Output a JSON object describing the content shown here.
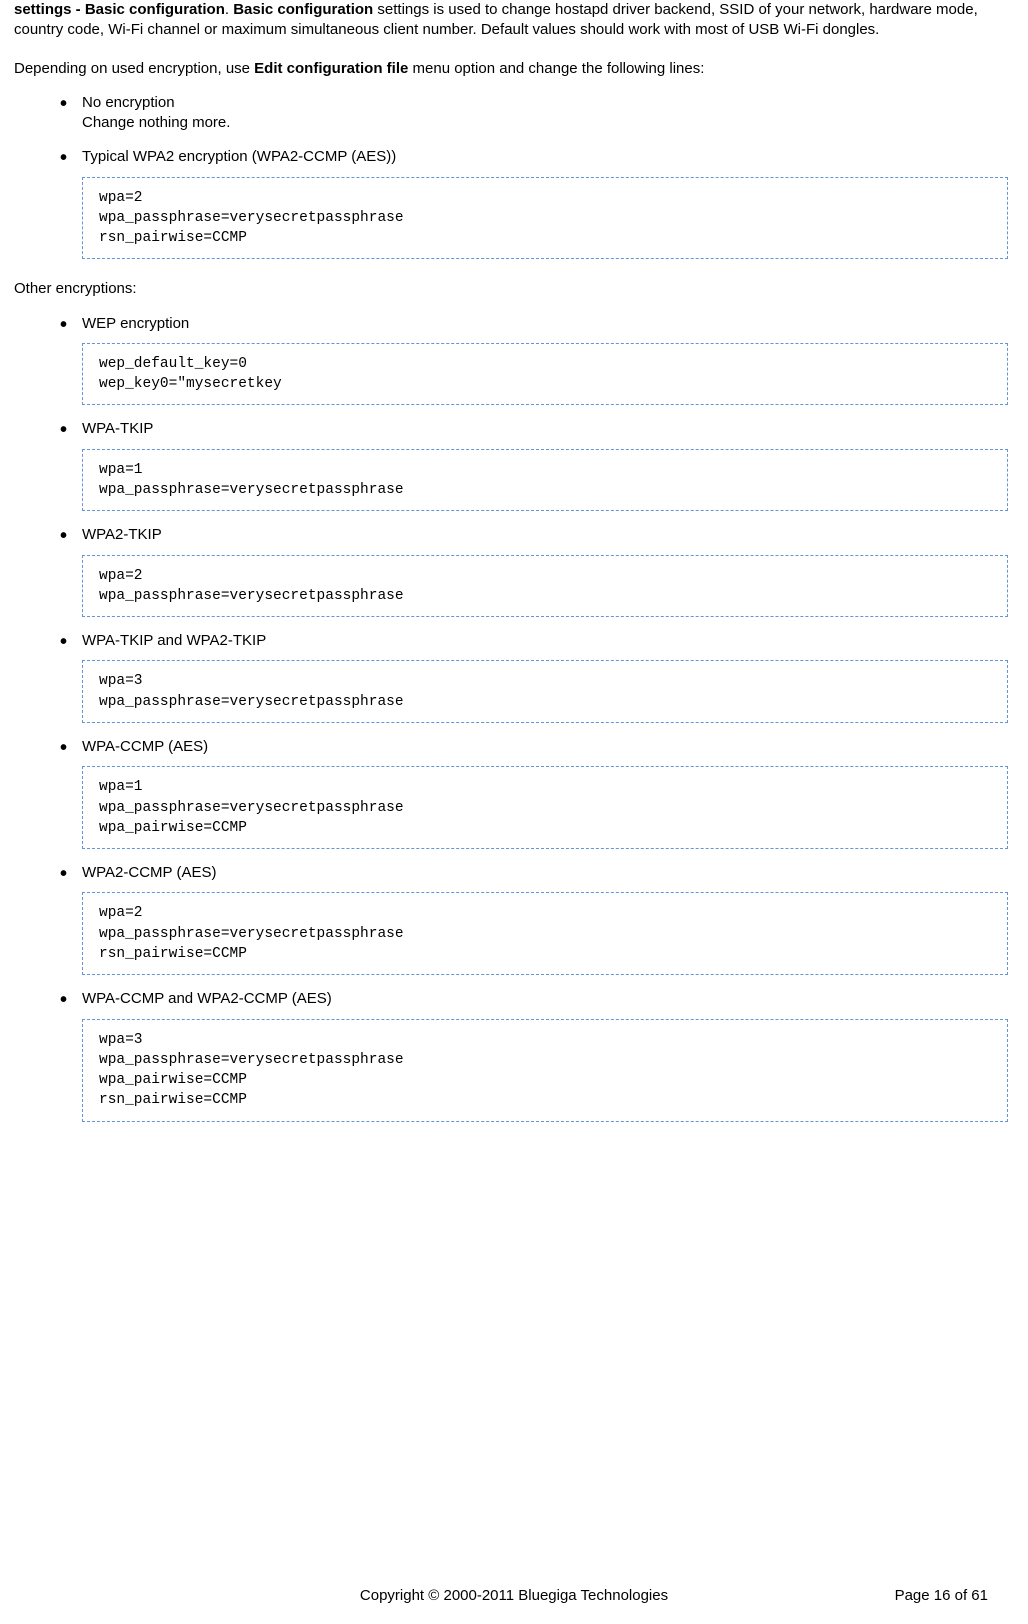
{
  "intro": {
    "prefix_bold": "settings - Basic configuration",
    "dot": ". ",
    "bold2": "Basic configuration",
    "rest": " settings is used to change hostapd driver backend, SSID of your network, hardware mode, country code, Wi-Fi channel or maximum simultaneous client number. Default values should work with most of USB Wi-Fi dongles."
  },
  "depending": {
    "pre": "Depending on used encryption, use ",
    "bold": "Edit configuration file",
    "post": " menu option and change the following lines:"
  },
  "list1": [
    {
      "title": "No encryption",
      "subtitle": "Change nothing more.",
      "code": null
    },
    {
      "title": "Typical WPA2 encryption (WPA2-CCMP (AES))",
      "subtitle": null,
      "code": "wpa=2\nwpa_passphrase=verysecretpassphrase\nrsn_pairwise=CCMP"
    }
  ],
  "other_heading": "Other encryptions:",
  "list2": [
    {
      "title": "WEP encryption",
      "code": "wep_default_key=0\nwep_key0=\"mysecretkey"
    },
    {
      "title": "WPA-TKIP",
      "code": "wpa=1\nwpa_passphrase=verysecretpassphrase"
    },
    {
      "title": "WPA2-TKIP",
      "code": "wpa=2\nwpa_passphrase=verysecretpassphrase"
    },
    {
      "title": "WPA-TKIP and WPA2-TKIP",
      "code": "wpa=3\nwpa_passphrase=verysecretpassphrase"
    },
    {
      "title": "WPA-CCMP (AES)",
      "code": "wpa=1\nwpa_passphrase=verysecretpassphrase\nwpa_pairwise=CCMP"
    },
    {
      "title": "WPA2-CCMP (AES)",
      "code": "wpa=2\nwpa_passphrase=verysecretpassphrase\nrsn_pairwise=CCMP"
    },
    {
      "title": "WPA-CCMP and WPA2-CCMP (AES)",
      "code": "wpa=3\nwpa_passphrase=verysecretpassphrase\nwpa_pairwise=CCMP\nrsn_pairwise=CCMP"
    }
  ],
  "footer": {
    "copyright": "Copyright © 2000-2011 Bluegiga Technologies",
    "page": "Page 16 of 61"
  }
}
